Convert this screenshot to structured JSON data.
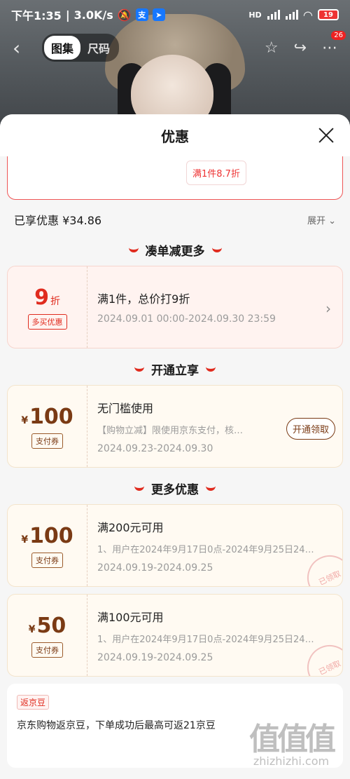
{
  "status": {
    "time": "下午1:35",
    "speed": "3.0K/s",
    "battery": "19",
    "hd": "HD"
  },
  "nav": {
    "back_icon": "chevron-left-icon",
    "tabs": [
      {
        "label": "图集",
        "active": true
      },
      {
        "label": "尺码",
        "active": false
      }
    ],
    "badge_count": "26"
  },
  "sheet": {
    "title": "优惠",
    "top_tag": "满1件8.7折",
    "enjoyed_label": "已享优惠 ¥34.86",
    "expand_label": "展开"
  },
  "sections": {
    "s1": "凑单减更多",
    "s2": "开通立享",
    "s3": "更多优惠"
  },
  "coupons": [
    {
      "amount": "9",
      "unit": "折",
      "tag": "多买优惠",
      "title": "满1件，总价打9折",
      "desc": "",
      "date": "2024.09.01 00:00-2024.09.30 23:59"
    },
    {
      "currency": "¥",
      "amount": "100",
      "tag": "支付券",
      "title": "无门槛使用",
      "desc": "【购物立减】限使用京东支付，核…",
      "date": "2024.09.23-2024.09.30",
      "button": "开通领取"
    },
    {
      "currency": "¥",
      "amount": "100",
      "tag": "支付券",
      "title": "满200元可用",
      "desc": "1、用户在2024年9月17日0点-2024年9月25日24…",
      "date": "2024.09.19-2024.09.25",
      "stamp": "已领取"
    },
    {
      "currency": "¥",
      "amount": "50",
      "tag": "支付券",
      "title": "满100元可用",
      "desc": "1、用户在2024年9月17日0点-2024年9月25日24…",
      "date": "2024.09.19-2024.09.25",
      "stamp": "已领取"
    }
  ],
  "bean": {
    "tag": "返京豆",
    "text": "京东购物返京豆，下单成功后最高可返21京豆"
  },
  "watermark": {
    "logo": "值值值",
    "site": "zhizhizhi.com"
  }
}
